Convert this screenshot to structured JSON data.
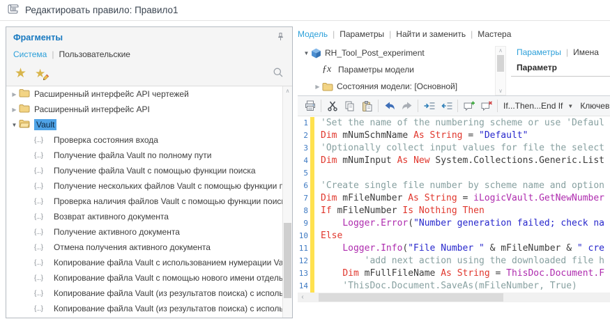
{
  "window": {
    "title": "Редактировать правило: Правило1"
  },
  "fragments": {
    "title": "Фрагменты",
    "tabs": [
      {
        "label": "Система",
        "active": true
      },
      {
        "label": "Пользовательские",
        "active": false
      }
    ],
    "tree": [
      {
        "kind": "folder",
        "expanded": false,
        "selected": false,
        "label": "Расширенный интерфейс API чертежей"
      },
      {
        "kind": "folder",
        "expanded": false,
        "selected": false,
        "label": "Расширенный интерфейс API"
      },
      {
        "kind": "folder",
        "expanded": true,
        "selected": true,
        "label": "Vault"
      },
      {
        "kind": "snippet",
        "label": "Проверка состояния входа"
      },
      {
        "kind": "snippet",
        "label": "Получение файла Vault по полному пути"
      },
      {
        "kind": "snippet",
        "label": "Получение файла Vault с помощью функции поиска"
      },
      {
        "kind": "snippet",
        "label": "Получение нескольких файлов Vault с помощью функции поиска"
      },
      {
        "kind": "snippet",
        "label": "Проверка наличия файлов Vault с помощью функции поиска"
      },
      {
        "kind": "snippet",
        "label": "Возврат активного документа"
      },
      {
        "kind": "snippet",
        "label": "Получение активного документа"
      },
      {
        "kind": "snippet",
        "label": "Отмена получения активного документа"
      },
      {
        "kind": "snippet",
        "label": "Копирование файла Vault с использованием нумерации Vault"
      },
      {
        "kind": "snippet",
        "label": "Копирование файла Vault с помощью нового имени отдельного"
      },
      {
        "kind": "snippet",
        "label": "Копирование файла Vault (из результатов поиска) с использов"
      },
      {
        "kind": "snippet",
        "label": "Копирование файла Vault (из результатов поиска) с использов"
      }
    ]
  },
  "model": {
    "tabs": [
      {
        "label": "Модель",
        "active": true
      },
      {
        "label": "Параметры",
        "active": false
      },
      {
        "label": "Найти и заменить",
        "active": false
      },
      {
        "label": "Мастера",
        "active": false
      }
    ],
    "tree": [
      {
        "icon": "cube",
        "expander": "expanded",
        "label": "RH_Tool_Post_experiment",
        "indent": 0
      },
      {
        "icon": "fx",
        "expander": "none",
        "label": "Параметры модели",
        "indent": 1
      },
      {
        "icon": "folder",
        "expander": "collapsed",
        "label": "Состояния модели: [Основной]",
        "indent": 1
      }
    ]
  },
  "params": {
    "tabs": [
      {
        "label": "Параметры",
        "active": true
      },
      {
        "label": "Имена",
        "active": false
      }
    ],
    "column": "Параметр"
  },
  "toolbar": {
    "icon_groups": [
      [
        "print"
      ],
      [
        "cut",
        "copy",
        "paste"
      ],
      [
        "undo",
        "redo"
      ],
      [
        "indent",
        "outdent"
      ],
      [
        "add-comment",
        "remove-comment"
      ]
    ],
    "if_then": "If...Then...End If",
    "keywords": "Ключевые слова"
  },
  "code": {
    "lines": [
      {
        "n": 1,
        "seg": [
          [
            "c",
            "'Set the name of the numbering scheme or use 'Defaul"
          ]
        ]
      },
      {
        "n": 2,
        "seg": [
          [
            "k",
            "Dim"
          ],
          [
            "p",
            " mNumSchmName "
          ],
          [
            "k",
            "As"
          ],
          [
            "p",
            " "
          ],
          [
            "k",
            "String"
          ],
          [
            "p",
            " = "
          ],
          [
            "s",
            "\"Default\""
          ]
        ]
      },
      {
        "n": 3,
        "seg": [
          [
            "c",
            "'Optionally collect input values for file the select"
          ]
        ]
      },
      {
        "n": 4,
        "seg": [
          [
            "k",
            "Dim"
          ],
          [
            "p",
            " mNumInput "
          ],
          [
            "k",
            "As"
          ],
          [
            "p",
            " "
          ],
          [
            "k",
            "New"
          ],
          [
            "p",
            " System.Collections.Generic.List"
          ]
        ]
      },
      {
        "n": 5,
        "seg": []
      },
      {
        "n": 6,
        "seg": [
          [
            "c",
            "'Create single file number by scheme name and option"
          ]
        ]
      },
      {
        "n": 7,
        "seg": [
          [
            "k",
            "Dim"
          ],
          [
            "p",
            " mFileNumber "
          ],
          [
            "k",
            "As"
          ],
          [
            "p",
            " "
          ],
          [
            "k",
            "String"
          ],
          [
            "p",
            " = "
          ],
          [
            "o",
            "iLogicVault.GetNewNumber"
          ]
        ]
      },
      {
        "n": 8,
        "seg": [
          [
            "k",
            "If"
          ],
          [
            "p",
            " mFileNumber "
          ],
          [
            "k",
            "Is"
          ],
          [
            "p",
            " "
          ],
          [
            "k",
            "Nothing"
          ],
          [
            "p",
            " "
          ],
          [
            "k",
            "Then"
          ]
        ]
      },
      {
        "n": 9,
        "seg": [
          [
            "p",
            "    "
          ],
          [
            "o",
            "Logger.Error"
          ],
          [
            "p",
            "("
          ],
          [
            "s",
            "\"Number generation failed; check na"
          ]
        ]
      },
      {
        "n": 10,
        "seg": [
          [
            "k",
            "Else"
          ]
        ]
      },
      {
        "n": 11,
        "seg": [
          [
            "p",
            "    "
          ],
          [
            "o",
            "Logger.Info"
          ],
          [
            "p",
            "("
          ],
          [
            "s",
            "\"File Number \""
          ],
          [
            "p",
            " & mFileNumber & "
          ],
          [
            "s",
            "\" cre"
          ]
        ]
      },
      {
        "n": 12,
        "seg": [
          [
            "p",
            "        "
          ],
          [
            "c",
            "'add next action using the downloaded file h"
          ]
        ]
      },
      {
        "n": 13,
        "seg": [
          [
            "p",
            "    "
          ],
          [
            "k",
            "Dim"
          ],
          [
            "p",
            " mFullFileName "
          ],
          [
            "k",
            "As"
          ],
          [
            "p",
            " "
          ],
          [
            "k",
            "String"
          ],
          [
            "p",
            " = "
          ],
          [
            "o",
            "ThisDoc.Document.F"
          ]
        ]
      },
      {
        "n": 14,
        "seg": [
          [
            "p",
            "    "
          ],
          [
            "c",
            "'ThisDoc.Document.SaveAs(mFileNumber, True)"
          ]
        ]
      }
    ]
  },
  "colors": {
    "accent_blue": "#2b9fd9",
    "header_blue": "#1879c0",
    "keyword": "#e0362c",
    "string": "#2727cc",
    "comment": "#87a0a0",
    "ilogic_object": "#ae2bae",
    "selection_bg": "#4fa3e6",
    "line_number": "#3d79c2",
    "modified_bar": "#ffe14f"
  }
}
